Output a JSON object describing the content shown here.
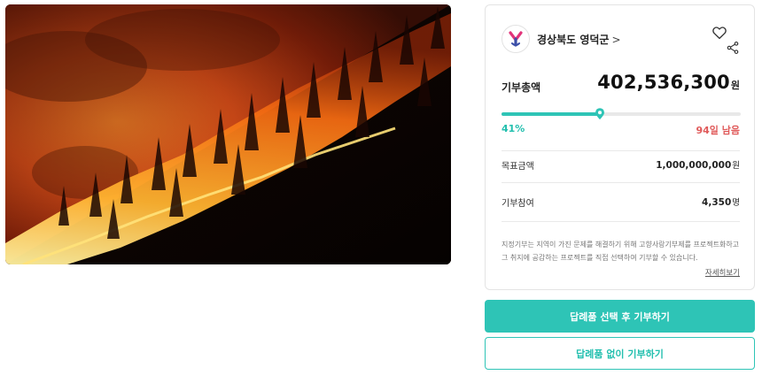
{
  "hero_image": {
    "subject": "wildfire-on-forested-hillside-at-night"
  },
  "organization": {
    "name": "경상북도 영덕군",
    "chevron": ">",
    "logo_icon": "municipality-y-logo-icon"
  },
  "actions": {
    "like_icon": "heart-icon",
    "share_icon": "share-icon"
  },
  "donation": {
    "total_label": "기부총액",
    "total_amount": "402,536,300",
    "total_unit": "원",
    "progress_fraction": 0.41,
    "percent_text": "41%",
    "days_left_text": "94일 남음",
    "goal_label": "목표금액",
    "goal_amount": "1,000,000,000",
    "goal_unit": "원",
    "participants_label": "기부참여",
    "participants_count": "4,350",
    "participants_unit": "명"
  },
  "description": {
    "text": "지정기부는 지역이 가진 문제를 해결하기 위해 고향사랑기부제를 프로젝트화하고 그 취지에 공감하는 프로젝트를 직접 선택하여 기부할 수 있습니다.",
    "more_link": "자세히보기"
  },
  "buttons": {
    "primary": "답례품 선택 후 기부하기",
    "secondary": "답례품 없이 기부하기"
  },
  "colors": {
    "accent": "#2ec4b6",
    "days_left": "#e05a5a",
    "fire_orange": "#ff7a1a"
  }
}
